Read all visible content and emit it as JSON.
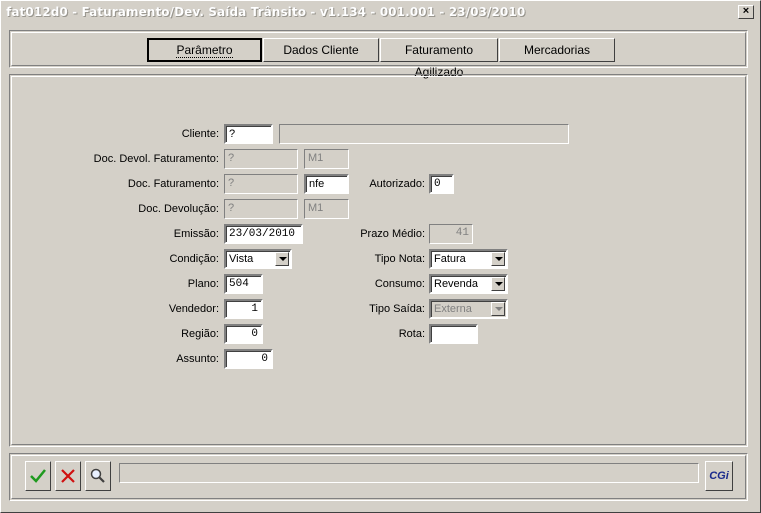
{
  "window": {
    "title": "fat012d0 - Faturamento/Dev. Saída Trânsito -  v1.134 - 001.001 - 23/03/2010",
    "close_label": "×"
  },
  "tabs": [
    {
      "label": "Parâmetro",
      "active": true
    },
    {
      "label": "Dados Cliente",
      "active": false
    },
    {
      "label": "Faturamento Agilizado",
      "active": false
    },
    {
      "label": "Mercadorias",
      "active": false
    }
  ],
  "form": {
    "cliente": {
      "label": "Cliente:",
      "code": "?",
      "name": ""
    },
    "doc_devol_faturamento": {
      "label": "Doc. Devol. Faturamento:",
      "value": "?",
      "serie": "M1"
    },
    "doc_faturamento": {
      "label": "Doc. Faturamento:",
      "value": "?",
      "serie": "nfe"
    },
    "autorizado": {
      "label": "Autorizado:",
      "value": "0"
    },
    "doc_devolucao": {
      "label": "Doc. Devolução:",
      "value": "?",
      "serie": "M1"
    },
    "emissao": {
      "label": "Emissão:",
      "value": "23/03/2010"
    },
    "prazo_medio": {
      "label": "Prazo Médio:",
      "value": "41"
    },
    "condicao": {
      "label": "Condição:",
      "value": "Vista"
    },
    "tipo_nota": {
      "label": "Tipo Nota:",
      "value": "Fatura"
    },
    "plano": {
      "label": "Plano:",
      "value": "504"
    },
    "consumo": {
      "label": "Consumo:",
      "value": "Revenda"
    },
    "vendedor": {
      "label": "Vendedor:",
      "value": "1"
    },
    "tipo_saida": {
      "label": "Tipo Saída:",
      "value": "Externa"
    },
    "regiao": {
      "label": "Região:",
      "value": "0"
    },
    "rota": {
      "label": "Rota:",
      "value": ""
    },
    "assunto": {
      "label": "Assunto:",
      "value": "0"
    }
  },
  "toolbar": {
    "confirm_icon": "check-icon",
    "cancel_icon": "x-icon",
    "search_icon": "magnifier-icon",
    "status_text": "",
    "logo_text": "CGi"
  },
  "colors": {
    "background": "#d4d0c8",
    "confirm": "#1f9a1f",
    "cancel": "#d01010",
    "logo": "#1a2a8c"
  }
}
